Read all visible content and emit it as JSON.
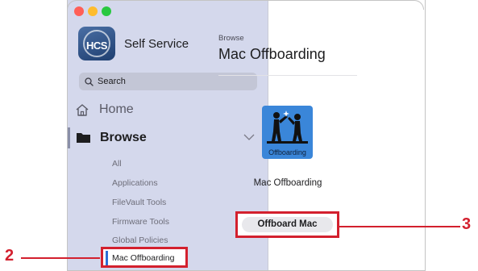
{
  "window": {
    "controls": [
      "close",
      "minimize",
      "zoom"
    ]
  },
  "app": {
    "logo_text": "HCS",
    "title": "Self Service"
  },
  "search": {
    "label": "Search",
    "icon": "search-icon"
  },
  "sidebar": {
    "home_label": "Home",
    "browse_label": "Browse",
    "browse_expanded": true,
    "sub_items": [
      {
        "label": "All"
      },
      {
        "label": "Applications"
      },
      {
        "label": "FileVault Tools"
      },
      {
        "label": "Firmware Tools"
      },
      {
        "label": "Global Policies"
      }
    ],
    "selected_item": "Mac Offboarding"
  },
  "content": {
    "breadcrumb": "Browse",
    "title": "Mac Offboarding",
    "item_icon_caption": "Offboarding",
    "item_name": "Mac Offboarding",
    "action_button": "Offboard Mac"
  },
  "annotations": {
    "callout_sidebar": "2",
    "callout_button": "3",
    "highlight_color": "#d3202e"
  },
  "colors": {
    "sidebar_bg": "#d4d8ec",
    "accent": "#2b6fd6",
    "icon_bg": "#3a86d9"
  }
}
